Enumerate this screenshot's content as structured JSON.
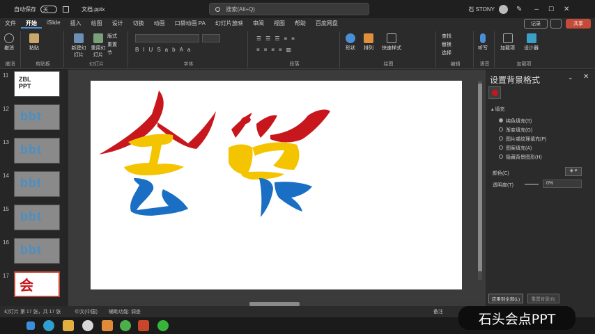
{
  "titlebar": {
    "autosave_label": "自动保存",
    "autosave_state": "关",
    "file_name": "文档.pptx",
    "search_placeholder": "搜索(Alt+Q)",
    "user_name": "石 STONY"
  },
  "menu": {
    "tabs": [
      "文件",
      "开始",
      "iSlide",
      "插入",
      "绘图",
      "设计",
      "切换",
      "动画",
      "口袋动画 PA",
      "幻灯片放映",
      "审阅",
      "视图",
      "帮助",
      "百度网盘"
    ],
    "active": "开始",
    "record_label": "记录",
    "share_label": "共享"
  },
  "ribbon": {
    "groups": [
      "撤消",
      "剪贴板",
      "幻灯片",
      "字体",
      "段落",
      "绘图",
      "编辑",
      "语音",
      "加载项"
    ],
    "undo_label": "撤消",
    "paste_label": "粘贴",
    "new_slide_label": "新建幻灯片",
    "reuse_label": "重用幻灯片",
    "layout_label": "版式",
    "reset_label": "重置",
    "section_label": "节",
    "shape_label": "形状",
    "arrange_label": "排列",
    "quick_style_label": "快速样式",
    "find_label": "查找",
    "replace_label": "替换",
    "select_label": "选择",
    "dictate_label": "听写",
    "addins_label": "加载项",
    "designer_label": "设计器"
  },
  "thumbnails": [
    {
      "num": "11",
      "type": "text",
      "text": "ZBL PPT"
    },
    {
      "num": "12",
      "type": "logo",
      "text": "bbt"
    },
    {
      "num": "13",
      "type": "logo",
      "text": "bbt"
    },
    {
      "num": "14",
      "type": "logo",
      "text": "bbt"
    },
    {
      "num": "15",
      "type": "logo",
      "text": "bbt"
    },
    {
      "num": "16",
      "type": "logo",
      "text": "bbt"
    },
    {
      "num": "17",
      "type": "active",
      "text": "会"
    }
  ],
  "pane": {
    "title": "设置背景格式",
    "section": "填充",
    "options": [
      "纯色填充(S)",
      "渐变填充(G)",
      "图片或纹理填充(P)",
      "图案填充(A)",
      "隐藏背景图形(H)"
    ],
    "color_label": "颜色(C)",
    "transparency_label": "透明度(T)",
    "transparency_value": "0%",
    "apply_all_label": "应用到全部(L)",
    "reset_bg_label": "重置背景(B)"
  },
  "status": {
    "slide_info": "幻灯片 第 17 张，共 17 张",
    "language": "中文(中国)",
    "accessibility": "辅助功能: 调查",
    "notes_label": "备注"
  },
  "watermark": "石头会点PPT",
  "colors": {
    "red": "#c8161d",
    "yellow": "#f5c400",
    "blue": "#1a6fc4",
    "accent": "#c44a3a"
  }
}
